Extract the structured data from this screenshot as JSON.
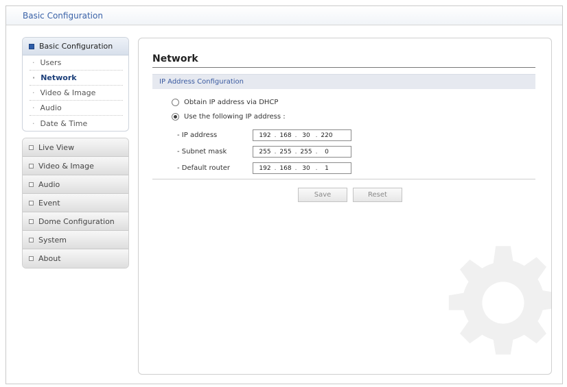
{
  "window": {
    "title": "Basic Configuration"
  },
  "sidebar": {
    "active_group": {
      "label": "Basic Configuration",
      "items": [
        {
          "label": "Users",
          "active": false
        },
        {
          "label": "Network",
          "active": true
        },
        {
          "label": "Video & Image",
          "active": false
        },
        {
          "label": "Audio",
          "active": false
        },
        {
          "label": "Date & Time",
          "active": false
        }
      ]
    },
    "menu": [
      {
        "label": "Live View"
      },
      {
        "label": "Video & Image"
      },
      {
        "label": "Audio"
      },
      {
        "label": "Event"
      },
      {
        "label": "Dome Configuration"
      },
      {
        "label": "System"
      },
      {
        "label": "About"
      }
    ]
  },
  "main": {
    "title": "Network",
    "section": "IP Address Configuration",
    "radio_dhcp": {
      "label": "Obtain IP address via DHCP",
      "selected": false
    },
    "radio_static": {
      "label": "Use the following IP address :",
      "selected": true
    },
    "fields": {
      "ip_address": {
        "label": "- IP address",
        "octets": [
          "192",
          "168",
          "30",
          "220"
        ]
      },
      "subnet_mask": {
        "label": "- Subnet mask",
        "octets": [
          "255",
          "255",
          "255",
          "0"
        ]
      },
      "default_router": {
        "label": "- Default router",
        "octets": [
          "192",
          "168",
          "30",
          "1"
        ]
      }
    },
    "buttons": {
      "save": "Save",
      "reset": "Reset"
    }
  },
  "colors": {
    "accent": "#3a62a8",
    "section_bg": "#e6e9f0",
    "active_item": "#1c3f7a"
  },
  "icons": {
    "active_group": "blue-square-icon",
    "menu_item": "grey-square-icon",
    "watermark": "gear-icon"
  }
}
